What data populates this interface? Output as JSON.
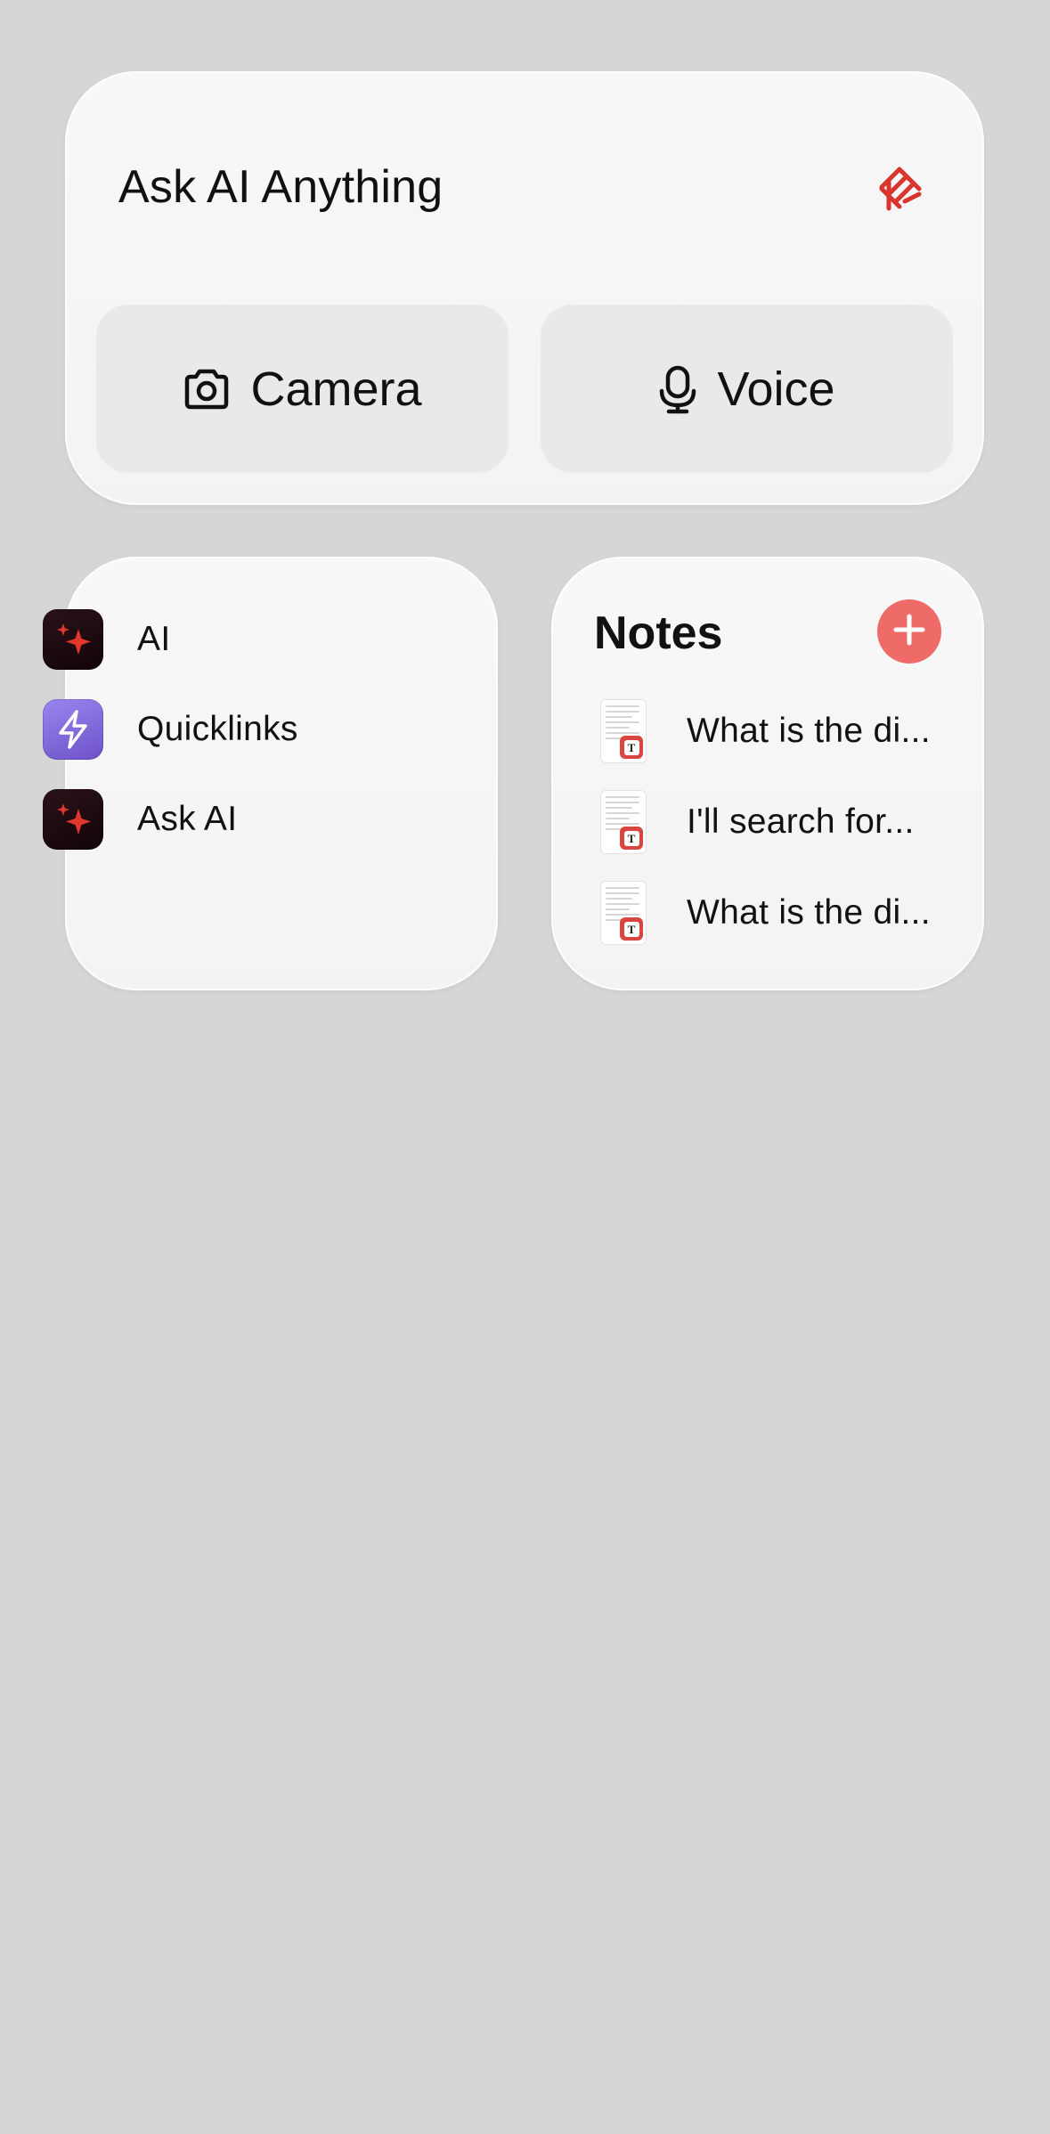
{
  "ask_widget": {
    "title": "Ask AI Anything",
    "logo_icon": "app-logo-icon",
    "buttons": {
      "camera": {
        "label": "Camera",
        "icon": "camera-icon"
      },
      "voice": {
        "label": "Voice",
        "icon": "microphone-icon"
      }
    }
  },
  "shortcuts_widget": {
    "items": [
      {
        "label": "AI",
        "icon": "sparkle-icon"
      },
      {
        "label": "Quicklinks",
        "icon": "lightning-icon"
      },
      {
        "label": "Ask AI",
        "icon": "sparkle-icon"
      }
    ]
  },
  "notes_widget": {
    "title": "Notes",
    "add_icon": "plus-icon",
    "items": [
      {
        "text": "What is the di..."
      },
      {
        "text": "I'll search for..."
      },
      {
        "text": "What is the di..."
      }
    ]
  },
  "colors": {
    "background": "#d6d6d6",
    "widget": "#f5f5f5",
    "button": "#e9e9e9",
    "accent_red": "#ef6b68",
    "logo_red": "#d9352f",
    "quicklinks_purple": "#8a74e3",
    "ai_icon_dark": "#1a0a0e"
  }
}
